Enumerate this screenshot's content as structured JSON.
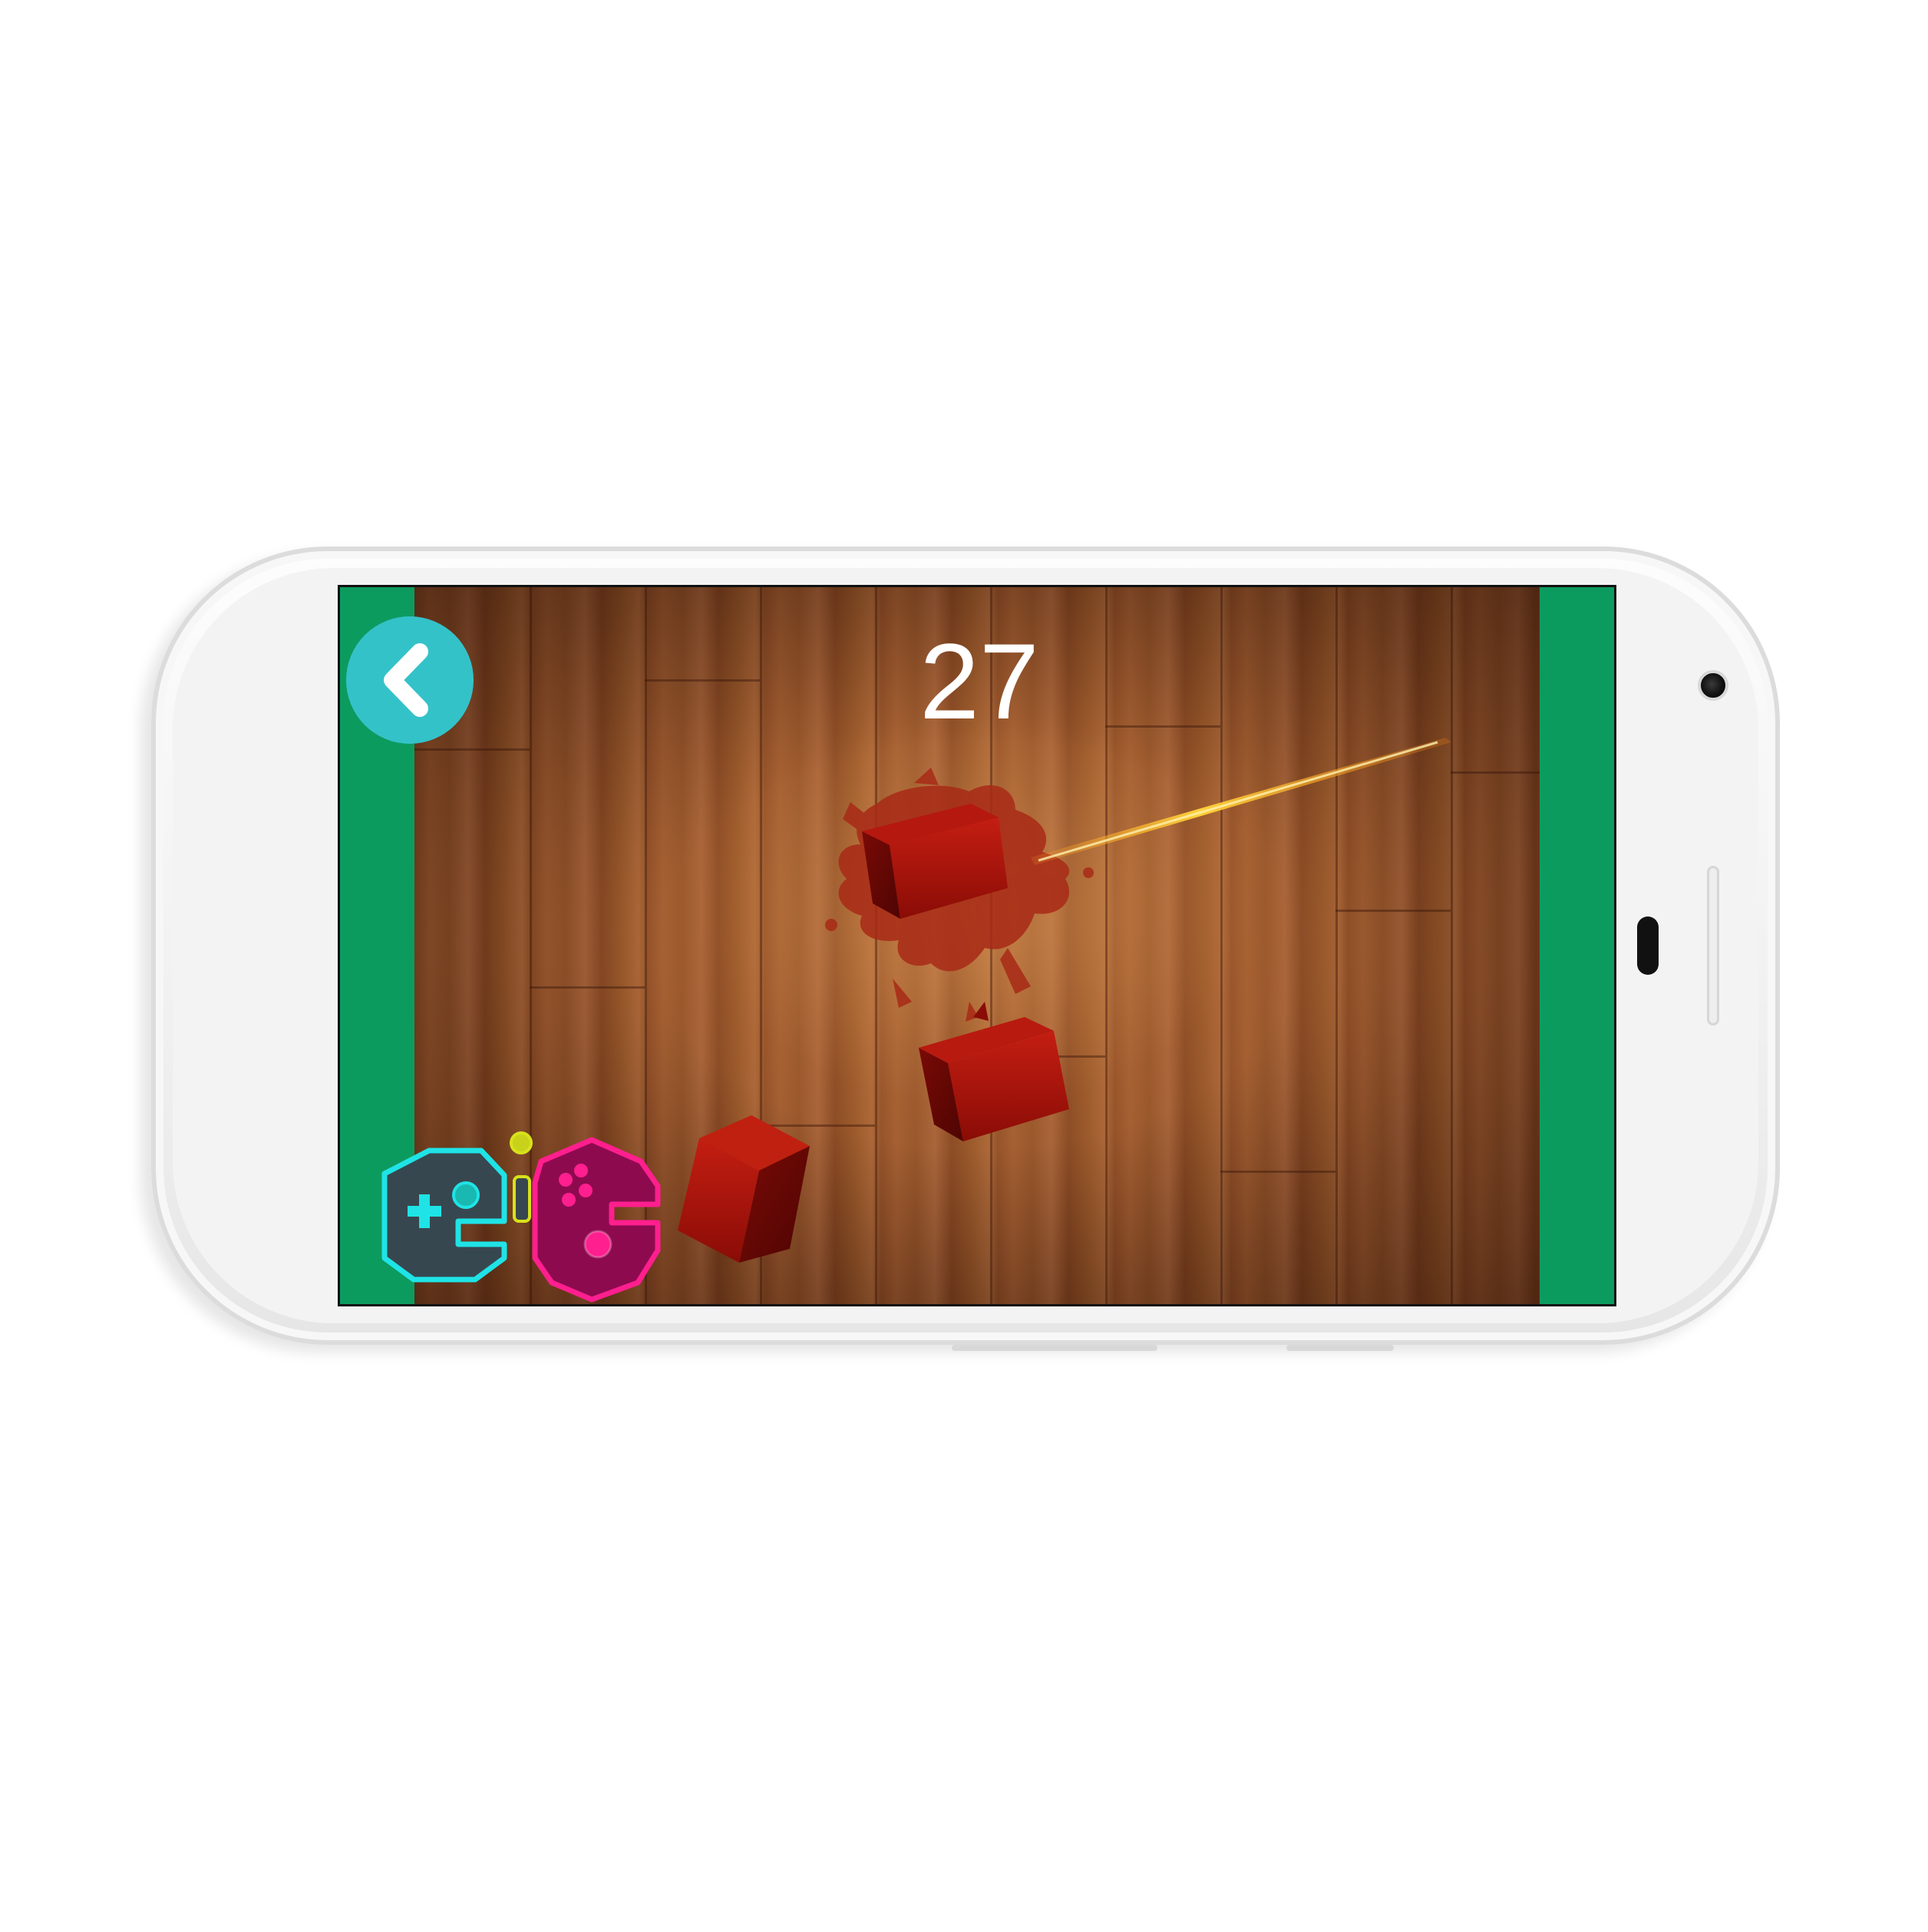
{
  "game": {
    "score": "27"
  },
  "controls": {
    "back_icon": "chevron-left-icon"
  },
  "colors": {
    "side_bars": "#0c9b5f",
    "back_button": "#34c2c9",
    "cube": "#9b0f0a",
    "splatter": "#a82a16",
    "slash": "#ffcc33",
    "logo_cyan": "#1fe3e6",
    "logo_magenta": "#ff1f8e",
    "logo_yellow": "#d8e21a"
  },
  "logo": {
    "left_icon": "gamepad-dpad-icon",
    "right_icon": "gamepad-buttons-icon"
  }
}
